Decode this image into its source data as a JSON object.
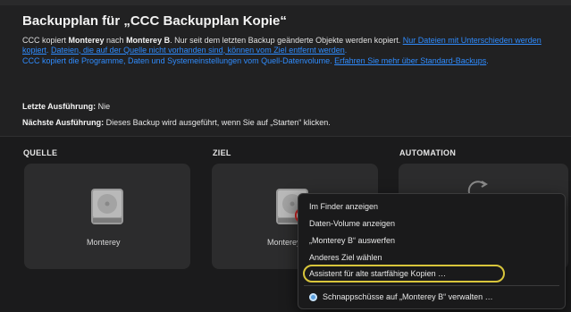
{
  "header": {
    "title": "Backupplan für „CCC Backupplan Kopie“",
    "line1_prefix": "CCC kopiert ",
    "line1_source": "Monterey",
    "line1_mid": " nach ",
    "line1_dest": "Monterey B",
    "line1_suffix": ". Nur seit dem letzten Backup geänderte Objekte werden kopiert. ",
    "link1": "Nur Dateien mit Unterschieden werden kopiert",
    "link2": "Dateien, die auf der Quelle nicht vorhanden sind, können vom Ziel entfernt werden",
    "line2_text": "CCC kopiert die Programme, Daten und Systemeinstellungen vom Quell-Datenvolume. ",
    "link3": "Erfahren Sie mehr über Standard-Backups",
    "last_run_label": "Letzte Ausführung:",
    "last_run_value": " Nie",
    "next_run_label": "Nächste Ausführung:",
    "next_run_value": " Dieses Backup wird ausgeführt, wenn Sie auf „Starten“ klicken."
  },
  "columns": {
    "source": "QUELLE",
    "target": "ZIEL",
    "automation": "AUTOMATION"
  },
  "source_disk": "Monterey",
  "target_disk": "Monterey B",
  "menu": {
    "items": [
      "Im Finder anzeigen",
      "Daten-Volume anzeigen",
      "„Monterey B“ auswerfen",
      "Anderes Ziel wählen",
      "Assistent für alte startfähige Kopien …",
      "Schnappschüsse auf „Monterey B“ verwalten …"
    ]
  },
  "colors": {
    "link": "#2f8cff",
    "highlight_ring": "#d8c53b",
    "background": "#1b1b1c"
  }
}
